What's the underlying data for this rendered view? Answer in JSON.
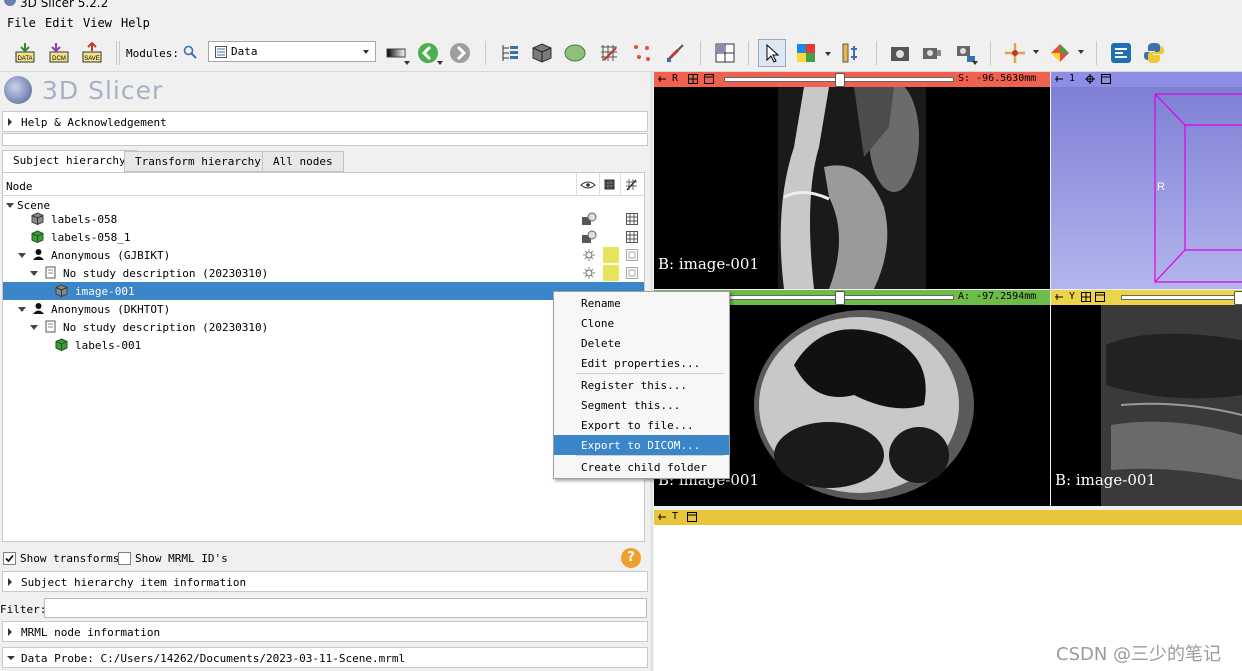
{
  "window": {
    "title": "3D Slicer 5.2.2"
  },
  "menu": [
    "File",
    "Edit",
    "View",
    "Help"
  ],
  "toolbar": {
    "data_label": "DATA",
    "dcm_label": "DCM",
    "save_label": "SAVE",
    "modules_label": "Modules:",
    "module_selected": "Data"
  },
  "app": {
    "logo_text": "3D Slicer"
  },
  "sections": {
    "help": "Help & Acknowledgement",
    "item_info": "Subject hierarchy item information",
    "mrml_info": "MRML node information",
    "data_probe": "Data Probe: C:/Users/14262/Documents/2023-03-11-Scene.mrml"
  },
  "tabs": [
    "Subject hierarchy",
    "Transform hierarchy",
    "All nodes"
  ],
  "tree": {
    "header": "Node",
    "rows": [
      {
        "label": "Scene"
      },
      {
        "label": "labels-058"
      },
      {
        "label": "labels-058_1"
      },
      {
        "label": "Anonymous (GJBIKT)"
      },
      {
        "label": "No study description (20230310)"
      },
      {
        "label": "image-001"
      },
      {
        "label": "Anonymous (DKHTOT)"
      },
      {
        "label": "No study description (20230310)"
      },
      {
        "label": "labels-001"
      }
    ]
  },
  "options": {
    "show_transforms": "Show transforms",
    "show_transforms_checked": true,
    "show_ids": "Show MRML ID's",
    "show_ids_checked": false
  },
  "filter": {
    "label": "Filter:",
    "value": ""
  },
  "context_menu": {
    "items": [
      "Rename",
      "Clone",
      "Delete",
      "Edit properties...",
      "Register this...",
      "Segment this...",
      "Export to file...",
      "Export to DICOM...",
      "Create child folder"
    ],
    "highlighted": "Export to DICOM..."
  },
  "views": {
    "red": {
      "letter": "R",
      "offset": "S: -96.5630mm",
      "label": "B: image-001",
      "color": "#f0614f"
    },
    "threeD": {
      "letter": "1",
      "axis_label": "R",
      "color": "#8e8ee6"
    },
    "green": {
      "offset": "A: -97.2594mm",
      "label": "B: image-001",
      "color": "#6dbc49"
    },
    "yellow": {
      "letter": "Y",
      "label": "B: image-001",
      "color": "#ecd34a"
    },
    "table": {
      "letter": "T",
      "color": "#e8c53a"
    }
  },
  "watermark": "CSDN @三少的笔记"
}
